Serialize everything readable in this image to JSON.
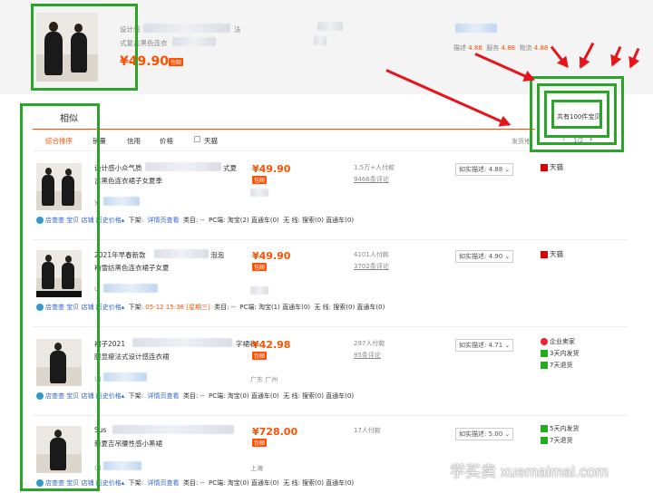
{
  "top": {
    "title_prefix": "设计感",
    "title_suffix": "法",
    "title_line2": "式复古黑色连衣",
    "price": "¥49.90",
    "badge": "包邮",
    "ratings": [
      {
        "label": "描述",
        "value": "4.88"
      },
      {
        "label": "服务",
        "value": "4.88"
      },
      {
        "label": "物流",
        "value": "4.88"
      }
    ]
  },
  "tabs": {
    "similar": "相似",
    "sort": [
      "综合排序",
      "销量",
      "信用",
      "价格"
    ],
    "tmall_filter": "天猫",
    "ship_label": "发货地",
    "pager": "1/2",
    "total": "共有100件宝贝"
  },
  "rows": [
    {
      "title1": "设计感小众气质",
      "title1b": "式夏",
      "title2": "古黑色连衣裙子女夏季",
      "shop": "yi",
      "price": "¥49.90",
      "badge": "包邮",
      "buyers": "1.5万+人付款",
      "reviews": "9466条评论",
      "match": "如实描述: 4.88",
      "badges": [
        {
          "text": "天猫",
          "icon": "tmall-icon",
          "color": "#d00"
        }
      ],
      "location": "",
      "shelf_time": "",
      "pc": "PC端: 淘宝(2) 直通车(0)",
      "mobile": "无 线: 搜索(0) 直通车(0)"
    },
    {
      "title1": "2021年早春新款",
      "title1b": "泡泡",
      "title2": "袖雪纺黑色连衣裙子女夏",
      "shop": "u",
      "price": "¥49.90",
      "badge": "包邮",
      "buyers": "4101人付款",
      "reviews": "3702条评论",
      "match": "如实描述: 4.90",
      "badges": [
        {
          "text": "天猫",
          "icon": "tmall-icon",
          "color": "#d00"
        }
      ],
      "location": "",
      "shelf_time": "05-12 15:38 [星期三]",
      "pc": "PC端: 淘宝(1) 直通车(0)",
      "mobile": "无 线: 搜索(0) 直通车(0)"
    },
    {
      "title1": "裙子2021",
      "title1b": "字裙收",
      "title2": "腰显瘦法式设计感连衣裙",
      "shop": "山",
      "price": "¥42.98",
      "badge": "包邮",
      "buyers": "297人付款",
      "reviews": "95条评论",
      "match": "如实描述: 4.71",
      "badges": [
        {
          "text": "企业卖家",
          "icon": "enterprise-icon",
          "color": "#e23"
        },
        {
          "text": "3天内发货",
          "icon": "ship-icon",
          "color": "#2a2"
        },
        {
          "text": "7天退货",
          "icon": "return-icon",
          "color": "#2a2"
        }
      ],
      "location": "广东 广州",
      "shelf_time": "",
      "pc": "PC端: 淘宝(0) 直通车(0)",
      "mobile": "无 线: 搜索(0) 直通车(0)"
    },
    {
      "title1": "Sus",
      "title1b": "",
      "title2": "新夏吉吊腰性感小黑裙",
      "shop": "山",
      "price": "¥728.00",
      "badge": "包邮",
      "buyers": "17人付款",
      "reviews": "",
      "match": "如实描述: 5.00",
      "badges": [
        {
          "text": "5天内发货",
          "icon": "ship-icon",
          "color": "#2a2"
        },
        {
          "text": "7天退货",
          "icon": "return-icon",
          "color": "#2a2"
        }
      ],
      "location": "上海",
      "shelf_time": "",
      "pc": "PC端: 淘宝(0) 直通车(0)",
      "mobile": "无 线: 搜索(0) 直通车(0)"
    }
  ],
  "row_links": [
    "店查查",
    "宝贝",
    "店铺",
    "历史价格",
    "下架",
    "详情页查看",
    "类目"
  ],
  "watermark": "学买卖 xuemaimai.com"
}
